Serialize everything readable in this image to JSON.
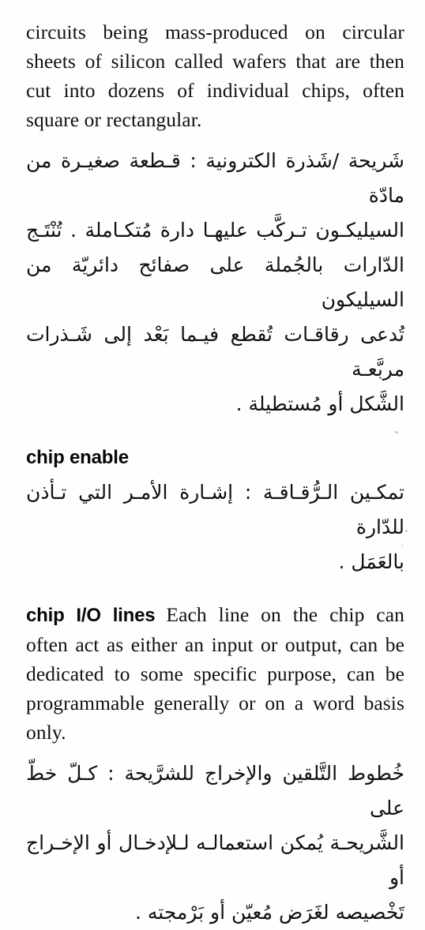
{
  "page": {
    "background_color": "#fefefe",
    "text_color": "#111111",
    "kind": "bilingual-dictionary-page"
  },
  "entries": [
    {
      "id": "chip-continued",
      "english_continuation": "circuits being mass-produced on circular sheets of silicon called wafers that are then cut into dozens of individual chips, often square or rectangular.",
      "arabic_lines": [
        "شَريحة /شَذرة الكترونية : قـطعة صغيـرة من مادّة",
        "السيليكـون تـركَّب عليهـا دارة مُتكـاملة . تُنْتَـج",
        "الدّارات بالجُملة على صفائح دائريّة من السيليكون",
        "تُدعى رقاقـات تُقطع فيـما بَعْد إلى شَـذرات مربَّعـة",
        "الشَّكل أو مُستطيلة ."
      ]
    },
    {
      "id": "chip-enable",
      "headword": "chip enable",
      "arabic_lines": [
        "تمكـين الـرُّقـاقـة : إشـارة الأمـر التي تـأذن للدّارة",
        "بالعَمَل ."
      ]
    },
    {
      "id": "chip-io-lines",
      "headword": "chip I/O lines",
      "english_definition": "Each line on the chip can often act as either an input or output, can be dedicated to some specific purpose, can be programmable generally or on a word basis only.",
      "arabic_lines": [
        "خُطوط التَّلقين والإخراج للشرَّيحة : كـلّ خطّ على",
        "الشَّريحـة يُمكن استعمالـه لـلإدخـال أو الإخـراج أو",
        "تَخْصيصه لغَرَض مُعيّن أو بَرْمجته ."
      ]
    }
  ]
}
